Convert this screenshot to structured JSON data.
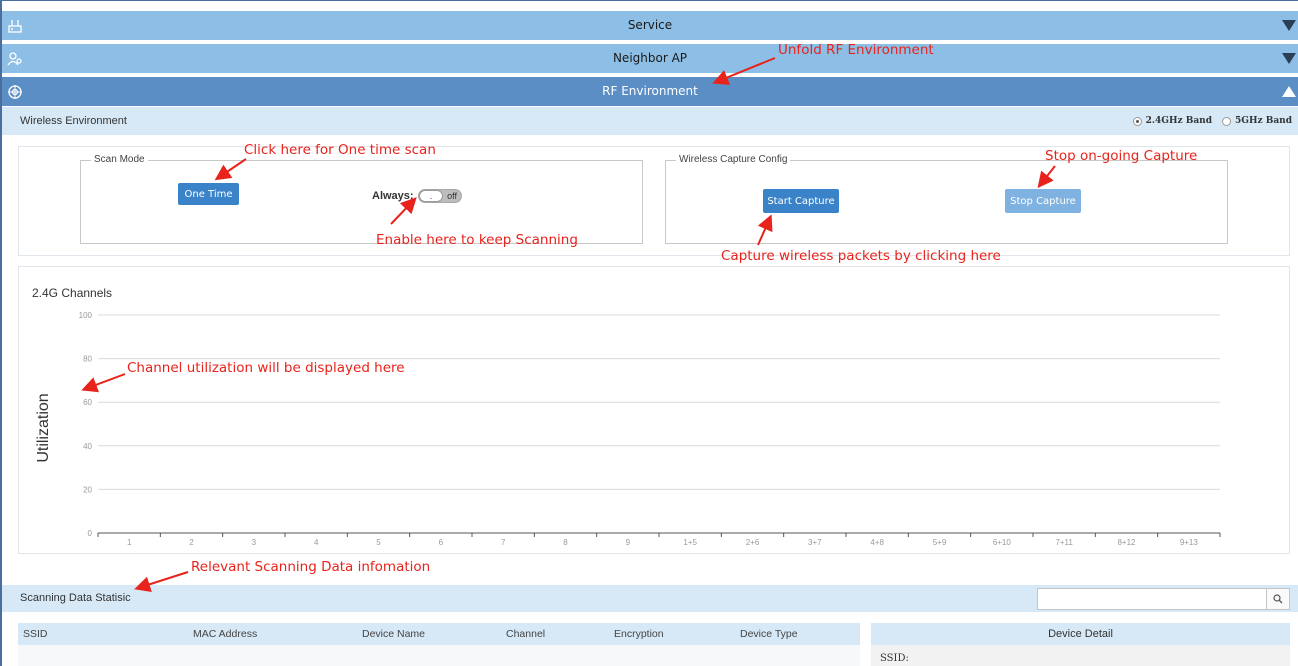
{
  "accordion": {
    "service": "Service",
    "neighbor_ap": "Neighbor AP",
    "rf_environment": "RF Environment"
  },
  "wireless_env": {
    "label": "Wireless Environment",
    "band_24": "2.4GHz Band",
    "band_5": "5GHz Band",
    "selected_band": "2.4GHz Band"
  },
  "scan_mode": {
    "legend": "Scan Mode",
    "one_time_button": "One Time",
    "always_label": "Always:",
    "toggle_knob": ".",
    "toggle_state": "off"
  },
  "capture": {
    "legend": "Wireless Capture Config",
    "start_button": "Start Capture",
    "stop_button": "Stop Capture"
  },
  "annotations": {
    "unfold": "Unfold RF Environment",
    "one_time": "Click here for One time scan",
    "enable": "Enable here to keep Scanning",
    "stop": "Stop on-going Capture",
    "capture": "Capture wireless packets by clicking here",
    "utilization": "Channel utilization will be displayed here",
    "scanning": "Relevant Scanning Data infomation"
  },
  "chart_data": {
    "type": "bar",
    "title": "2.4G Channels",
    "xlabel": "",
    "ylabel": "Utilization",
    "categories": [
      "1",
      "2",
      "3",
      "4",
      "5",
      "6",
      "7",
      "8",
      "9",
      "1+5",
      "2+6",
      "3+7",
      "4+8",
      "5+9",
      "6+10",
      "7+11",
      "8+12",
      "9+13"
    ],
    "yticks": [
      "0",
      "20",
      "40",
      "60",
      "80",
      "100"
    ],
    "ylim": [
      0,
      100
    ],
    "series": [],
    "grid": true
  },
  "scanning": {
    "label": "Scanning Data Statisic",
    "search_value": "",
    "search_icon": "search-icon",
    "columns": [
      "SSID",
      "MAC Address",
      "Device Name",
      "Channel",
      "Encryption",
      "Device Type"
    ],
    "detail_title": "Device Detail",
    "detail_ssid": "SSID:"
  },
  "colors": {
    "bar_light": "#8dbfe6",
    "bar_active": "#5b8ec4",
    "button": "#3b83c9",
    "annotation": "#e8231c"
  }
}
